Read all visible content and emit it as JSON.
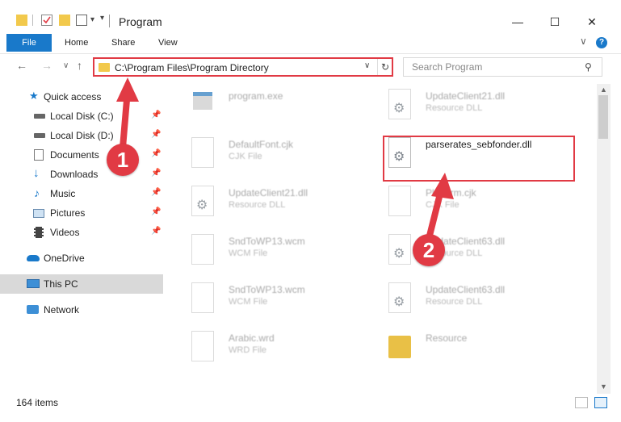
{
  "window": {
    "title": "Program",
    "minimize_glyph": "—",
    "maximize_glyph": "☐",
    "close_glyph": "✕"
  },
  "ribbon": {
    "tabs": [
      "File",
      "Home",
      "Share",
      "View"
    ],
    "expand_glyph": "∨",
    "help_glyph": "?"
  },
  "nav": {
    "back_glyph": "←",
    "forward_glyph": "→",
    "recent_glyph": "∨",
    "up_glyph": "↑"
  },
  "address": {
    "path": "C:\\Program Files\\Program Directory",
    "dropdown_glyph": "∨",
    "refresh_glyph": "↻"
  },
  "search": {
    "placeholder": "Search Program",
    "icon_glyph": "⚲"
  },
  "sidebar": {
    "pin_glyph": "📌",
    "items": [
      {
        "label": "Quick access",
        "icon": "star-icon"
      },
      {
        "label": "Local Disk (C:)",
        "icon": "drive-icon",
        "pinned": true
      },
      {
        "label": "Local Disk (D:)",
        "icon": "drive-icon",
        "pinned": true
      },
      {
        "label": "Documents",
        "icon": "documents-icon",
        "pinned": true
      },
      {
        "label": "Downloads",
        "icon": "download-icon",
        "pinned": true
      },
      {
        "label": "Music",
        "icon": "music-icon",
        "pinned": true
      },
      {
        "label": "Pictures",
        "icon": "pictures-icon",
        "pinned": true
      },
      {
        "label": "Videos",
        "icon": "videos-icon",
        "pinned": true
      },
      {
        "label": "OneDrive",
        "icon": "cloud-icon"
      },
      {
        "label": "This PC",
        "icon": "computer-icon",
        "selected": true
      },
      {
        "label": "Network",
        "icon": "network-icon"
      }
    ]
  },
  "files": [
    {
      "name": "program.exe",
      "type": "",
      "kind": "exe"
    },
    {
      "name": "UpdateClient21.dll",
      "type": "Resource DLL",
      "kind": "dll"
    },
    {
      "name": "DefaultFont.cjk",
      "type": "CJK File",
      "kind": "doc"
    },
    {
      "name": "parserates_sebfonder.dll",
      "type": "",
      "kind": "dll",
      "highlight": true
    },
    {
      "name": "UpdateClient21.dll",
      "type": "Resource DLL",
      "kind": "dll"
    },
    {
      "name": "Platform.cjk",
      "type": "CJK File",
      "kind": "doc"
    },
    {
      "name": "SndToWP13.wcm",
      "type": "WCM File",
      "kind": "doc"
    },
    {
      "name": "UpdateClient63.dll",
      "type": "Resource DLL",
      "kind": "dll"
    },
    {
      "name": "SndToWP13.wcm",
      "type": "WCM File",
      "kind": "doc"
    },
    {
      "name": "UpdateClient63.dll",
      "type": "Resource DLL",
      "kind": "dll"
    },
    {
      "name": "Arabic.wrd",
      "type": "WRD File",
      "kind": "doc"
    },
    {
      "name": "Resource",
      "type": "",
      "kind": "folder"
    }
  ],
  "status": {
    "item_count": "164 items"
  },
  "callouts": [
    "1",
    "2"
  ],
  "colors": {
    "accent": "#1979ca",
    "callout_red": "#e13a44",
    "selection": "#d9d9d9"
  }
}
